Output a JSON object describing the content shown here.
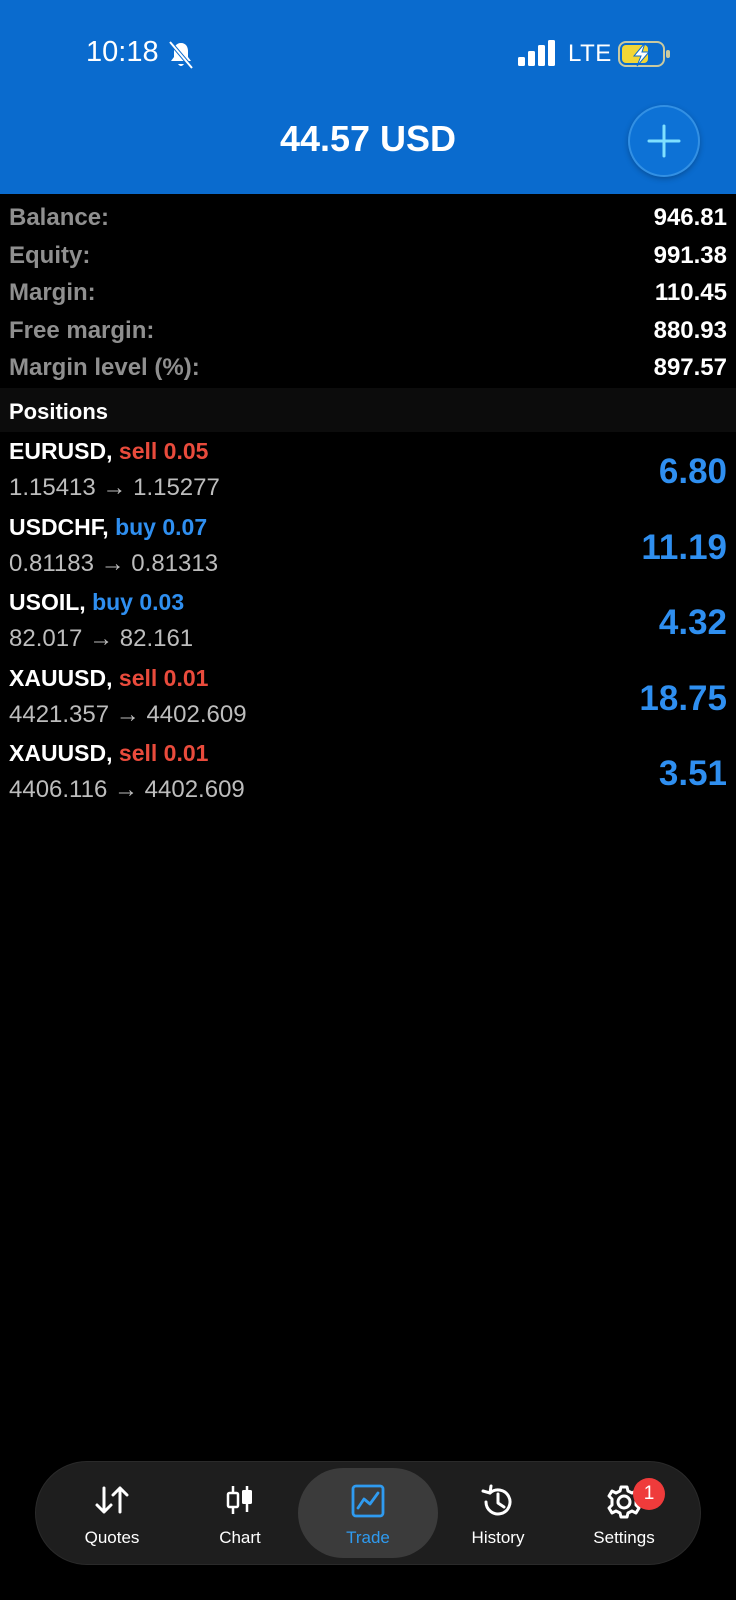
{
  "status_bar": {
    "time": "10:18",
    "network": "LTE"
  },
  "header": {
    "title": "44.57 USD"
  },
  "summary": [
    {
      "label": "Balance:",
      "value": "946.81"
    },
    {
      "label": "Equity:",
      "value": "991.38"
    },
    {
      "label": "Margin:",
      "value": "110.45"
    },
    {
      "label": "Free margin:",
      "value": "880.93"
    },
    {
      "label": "Margin level (%):",
      "value": "897.57"
    }
  ],
  "positions_section": {
    "title": "Positions"
  },
  "positions": [
    {
      "symbol": "EURUSD,",
      "side": "sell 0.05",
      "prices": "1.15413 → 1.15277",
      "profit": "6.80"
    },
    {
      "symbol": "USDCHF,",
      "side": "buy 0.07",
      "prices": "0.81183 → 0.81313",
      "profit": "11.19"
    },
    {
      "symbol": "USOIL,",
      "side": "buy 0.03",
      "prices": "82.017 → 82.161",
      "profit": "4.32"
    },
    {
      "symbol": "XAUUSD,",
      "side": "sell 0.01",
      "prices": "4421.357 → 4402.609",
      "profit": "18.75"
    },
    {
      "symbol": "XAUUSD,",
      "side": "sell 0.01",
      "prices": "4406.116 → 4402.609",
      "profit": "3.51"
    }
  ],
  "tabs": [
    {
      "label": "Quotes",
      "icon": "quotes-arrows-icon"
    },
    {
      "label": "Chart",
      "icon": "candlestick-icon"
    },
    {
      "label": "Trade",
      "icon": "trade-chart-icon",
      "active": true
    },
    {
      "label": "History",
      "icon": "history-clock-icon"
    },
    {
      "label": "Settings",
      "icon": "gear-icon",
      "badge": "1"
    }
  ],
  "colors": {
    "header_bg": "#0a6bce",
    "sell": "#e94b3c",
    "buy": "#2f8ff0",
    "profit": "#2f8ff0",
    "active_tab": "#2f9bf0",
    "badge": "#ef3b3b"
  }
}
